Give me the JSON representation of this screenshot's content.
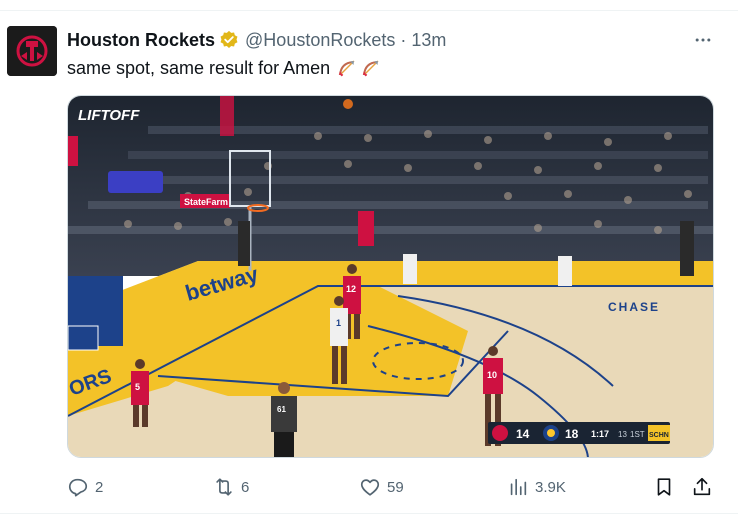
{
  "tweet": {
    "author_name": "Houston Rockets",
    "handle": "@HoustonRockets",
    "separator": "·",
    "time": "13m",
    "text": "same spot, same result for Amen",
    "verified": true
  },
  "media": {
    "watermark": "LIFTOFF",
    "scoreboard": {
      "home_score": "14",
      "away_score": "18",
      "clock": "1:17",
      "shot_clock": "13",
      "period": "1ST",
      "network": "SCHN"
    },
    "court_text": {
      "sponsor": "betway",
      "baseline": "CHASE",
      "state_farm": "StateFarm"
    },
    "jerseys": [
      "5",
      "12",
      "1",
      "10",
      "61"
    ]
  },
  "actions": {
    "replies": "2",
    "reposts": "6",
    "likes": "59",
    "views": "3.9K"
  },
  "icons": {
    "more": "more-icon",
    "verified": "verified-badge-icon",
    "reply": "reply-icon",
    "repost": "repost-icon",
    "like": "like-icon",
    "views": "views-icon",
    "bookmark": "bookmark-icon",
    "share": "share-icon",
    "emoji": "bow-and-arrow-emoji"
  },
  "colors": {
    "rockets_red": "#ce1141",
    "text_secondary": "#536471",
    "verified_gold": "#e2b719"
  }
}
